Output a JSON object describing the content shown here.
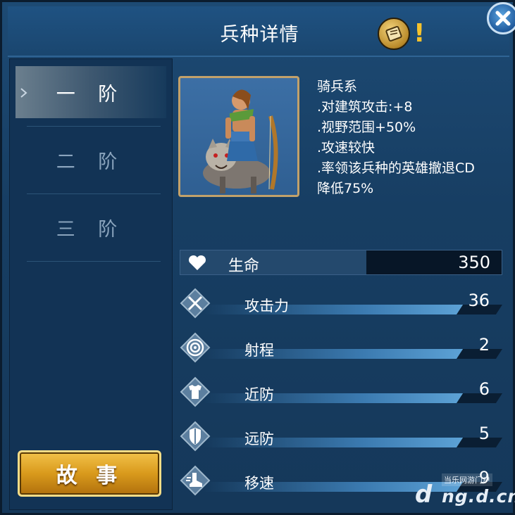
{
  "header": {
    "title": "兵种详情",
    "help_mark": "!"
  },
  "tiers": [
    {
      "label": "一 阶",
      "active": true
    },
    {
      "label": "二 阶",
      "active": false
    },
    {
      "label": "三 阶",
      "active": false
    }
  ],
  "story_button": {
    "label": "故 事"
  },
  "unit": {
    "description": [
      "骑兵系",
      ".对建筑攻击:+8",
      ".视野范围+50%",
      ".攻速较快",
      ".率领该兵种的英雄撤退CD",
      "降低75%"
    ]
  },
  "health": {
    "label": "生命",
    "value": "350",
    "icon": "heart-icon"
  },
  "stats": [
    {
      "label": "攻击力",
      "value": "36",
      "icon": "crossed-swords-icon"
    },
    {
      "label": "射程",
      "value": "2",
      "icon": "target-icon"
    },
    {
      "label": "近防",
      "value": "6",
      "icon": "armor-icon"
    },
    {
      "label": "远防",
      "value": "5",
      "icon": "shield-icon"
    },
    {
      "label": "移速",
      "value": "9",
      "icon": "boot-icon"
    }
  ],
  "watermark": {
    "site": "ng.d.cn",
    "tag": "当乐网游门户",
    "logo": "d"
  }
}
